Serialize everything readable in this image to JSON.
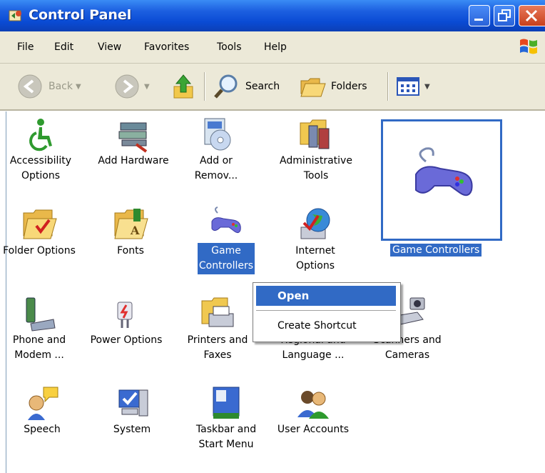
{
  "window": {
    "title": "Control Panel"
  },
  "menu": [
    "File",
    "Edit",
    "View",
    "Favorites",
    "Tools",
    "Help"
  ],
  "toolbar": {
    "back_label": "Back",
    "search_label": "Search",
    "folders_label": "Folders"
  },
  "items": [
    {
      "label1": "Accessibility",
      "label2": "Options",
      "icon": "accessibility-icon"
    },
    {
      "label1": "Add Hardware",
      "label2": "",
      "icon": "add-hardware-icon"
    },
    {
      "label1": "Add or",
      "label2": "Remov...",
      "icon": "add-remove-programs-icon"
    },
    {
      "label1": "Administrative",
      "label2": "Tools",
      "icon": "administrative-tools-icon"
    },
    {
      "label1": "Folder Options",
      "label2": "",
      "icon": "folder-options-icon"
    },
    {
      "label1": "Fonts",
      "label2": "",
      "icon": "fonts-icon"
    },
    {
      "label1": "Game",
      "label2": "Controllers",
      "icon": "gamepad-icon"
    },
    {
      "label1": "Internet",
      "label2": "Options",
      "icon": "internet-options-icon"
    },
    {
      "label1": "Phone and",
      "label2": "Modem ...",
      "icon": "phone-modem-icon"
    },
    {
      "label1": "Power Options",
      "label2": "",
      "icon": "power-options-icon"
    },
    {
      "label1": "Printers and",
      "label2": "Faxes",
      "icon": "printers-faxes-icon"
    },
    {
      "label1": "Regional and",
      "label2": "Language ...",
      "icon": "regional-language-icon"
    },
    {
      "label1": "Scanners and",
      "label2": "Cameras",
      "icon": "scanners-cameras-icon"
    },
    {
      "label1": "Speech",
      "label2": "",
      "icon": "speech-icon"
    },
    {
      "label1": "System",
      "label2": "",
      "icon": "system-icon"
    },
    {
      "label1": "Taskbar and",
      "label2": "Start Menu",
      "icon": "taskbar-start-menu-icon"
    },
    {
      "label1": "User Accounts",
      "label2": "",
      "icon": "user-accounts-icon"
    }
  ],
  "preview": {
    "label": "Game Controllers"
  },
  "context_menu": {
    "open": "Open",
    "create_shortcut": "Create Shortcut"
  },
  "colors": {
    "titlebar": "#0a4bd4",
    "selection": "#316ac5",
    "chrome": "#ece9d8"
  }
}
